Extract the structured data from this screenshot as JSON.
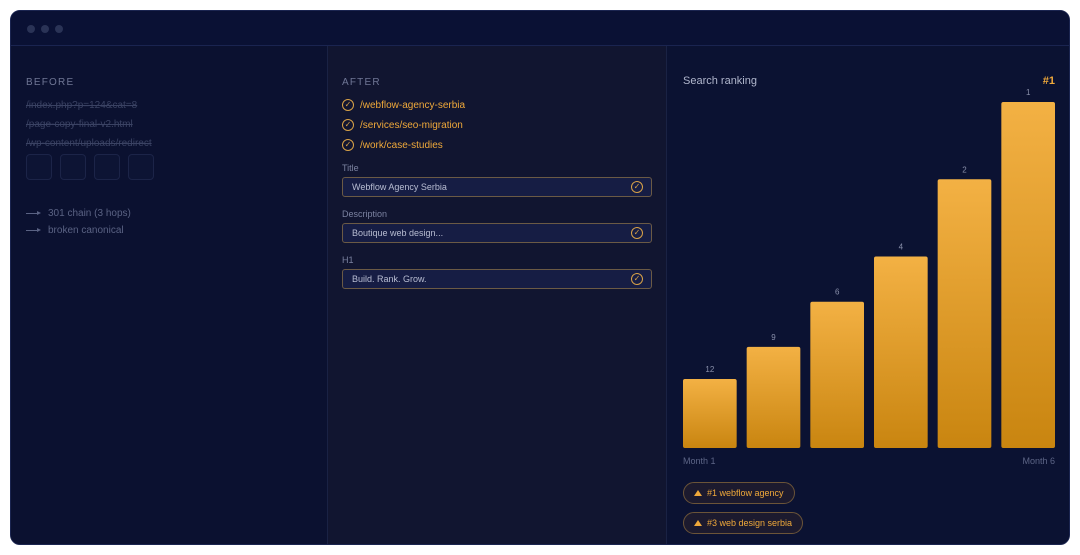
{
  "before": {
    "label": "Before",
    "old_urls": [
      "/index.php?p=124&cat=8",
      "/page-copy-final-v2.html",
      "/wp-content/uploads/redirect"
    ],
    "issues": [
      "301 chain (3 hops)",
      "broken canonical"
    ]
  },
  "after": {
    "label": "After",
    "new_urls": [
      "/webflow-agency-serbia",
      "/services/seo-migration",
      "/work/case-studies"
    ],
    "fields": [
      {
        "label": "Title",
        "value": "Webflow Agency Serbia"
      },
      {
        "label": "Description",
        "value": "Boutique web design..."
      },
      {
        "label": "H1",
        "value": "Build. Rank. Grow."
      }
    ]
  },
  "ranking": {
    "title": "Search ranking",
    "current": "#1",
    "chips": [
      "#1 webflow agency",
      "#3 web design serbia"
    ]
  },
  "colors": {
    "accent": "#f0a93a",
    "bar_top": "#f3b144",
    "bar_bottom": "#c98510"
  },
  "chart_data": {
    "type": "bar",
    "categories": [
      "Month 1",
      "",
      "",
      "",
      "",
      "Month 6"
    ],
    "values": [
      12,
      9,
      6,
      4,
      2,
      1
    ],
    "xlabel": "",
    "ylabel": "",
    "grid": false,
    "legend": "none"
  }
}
